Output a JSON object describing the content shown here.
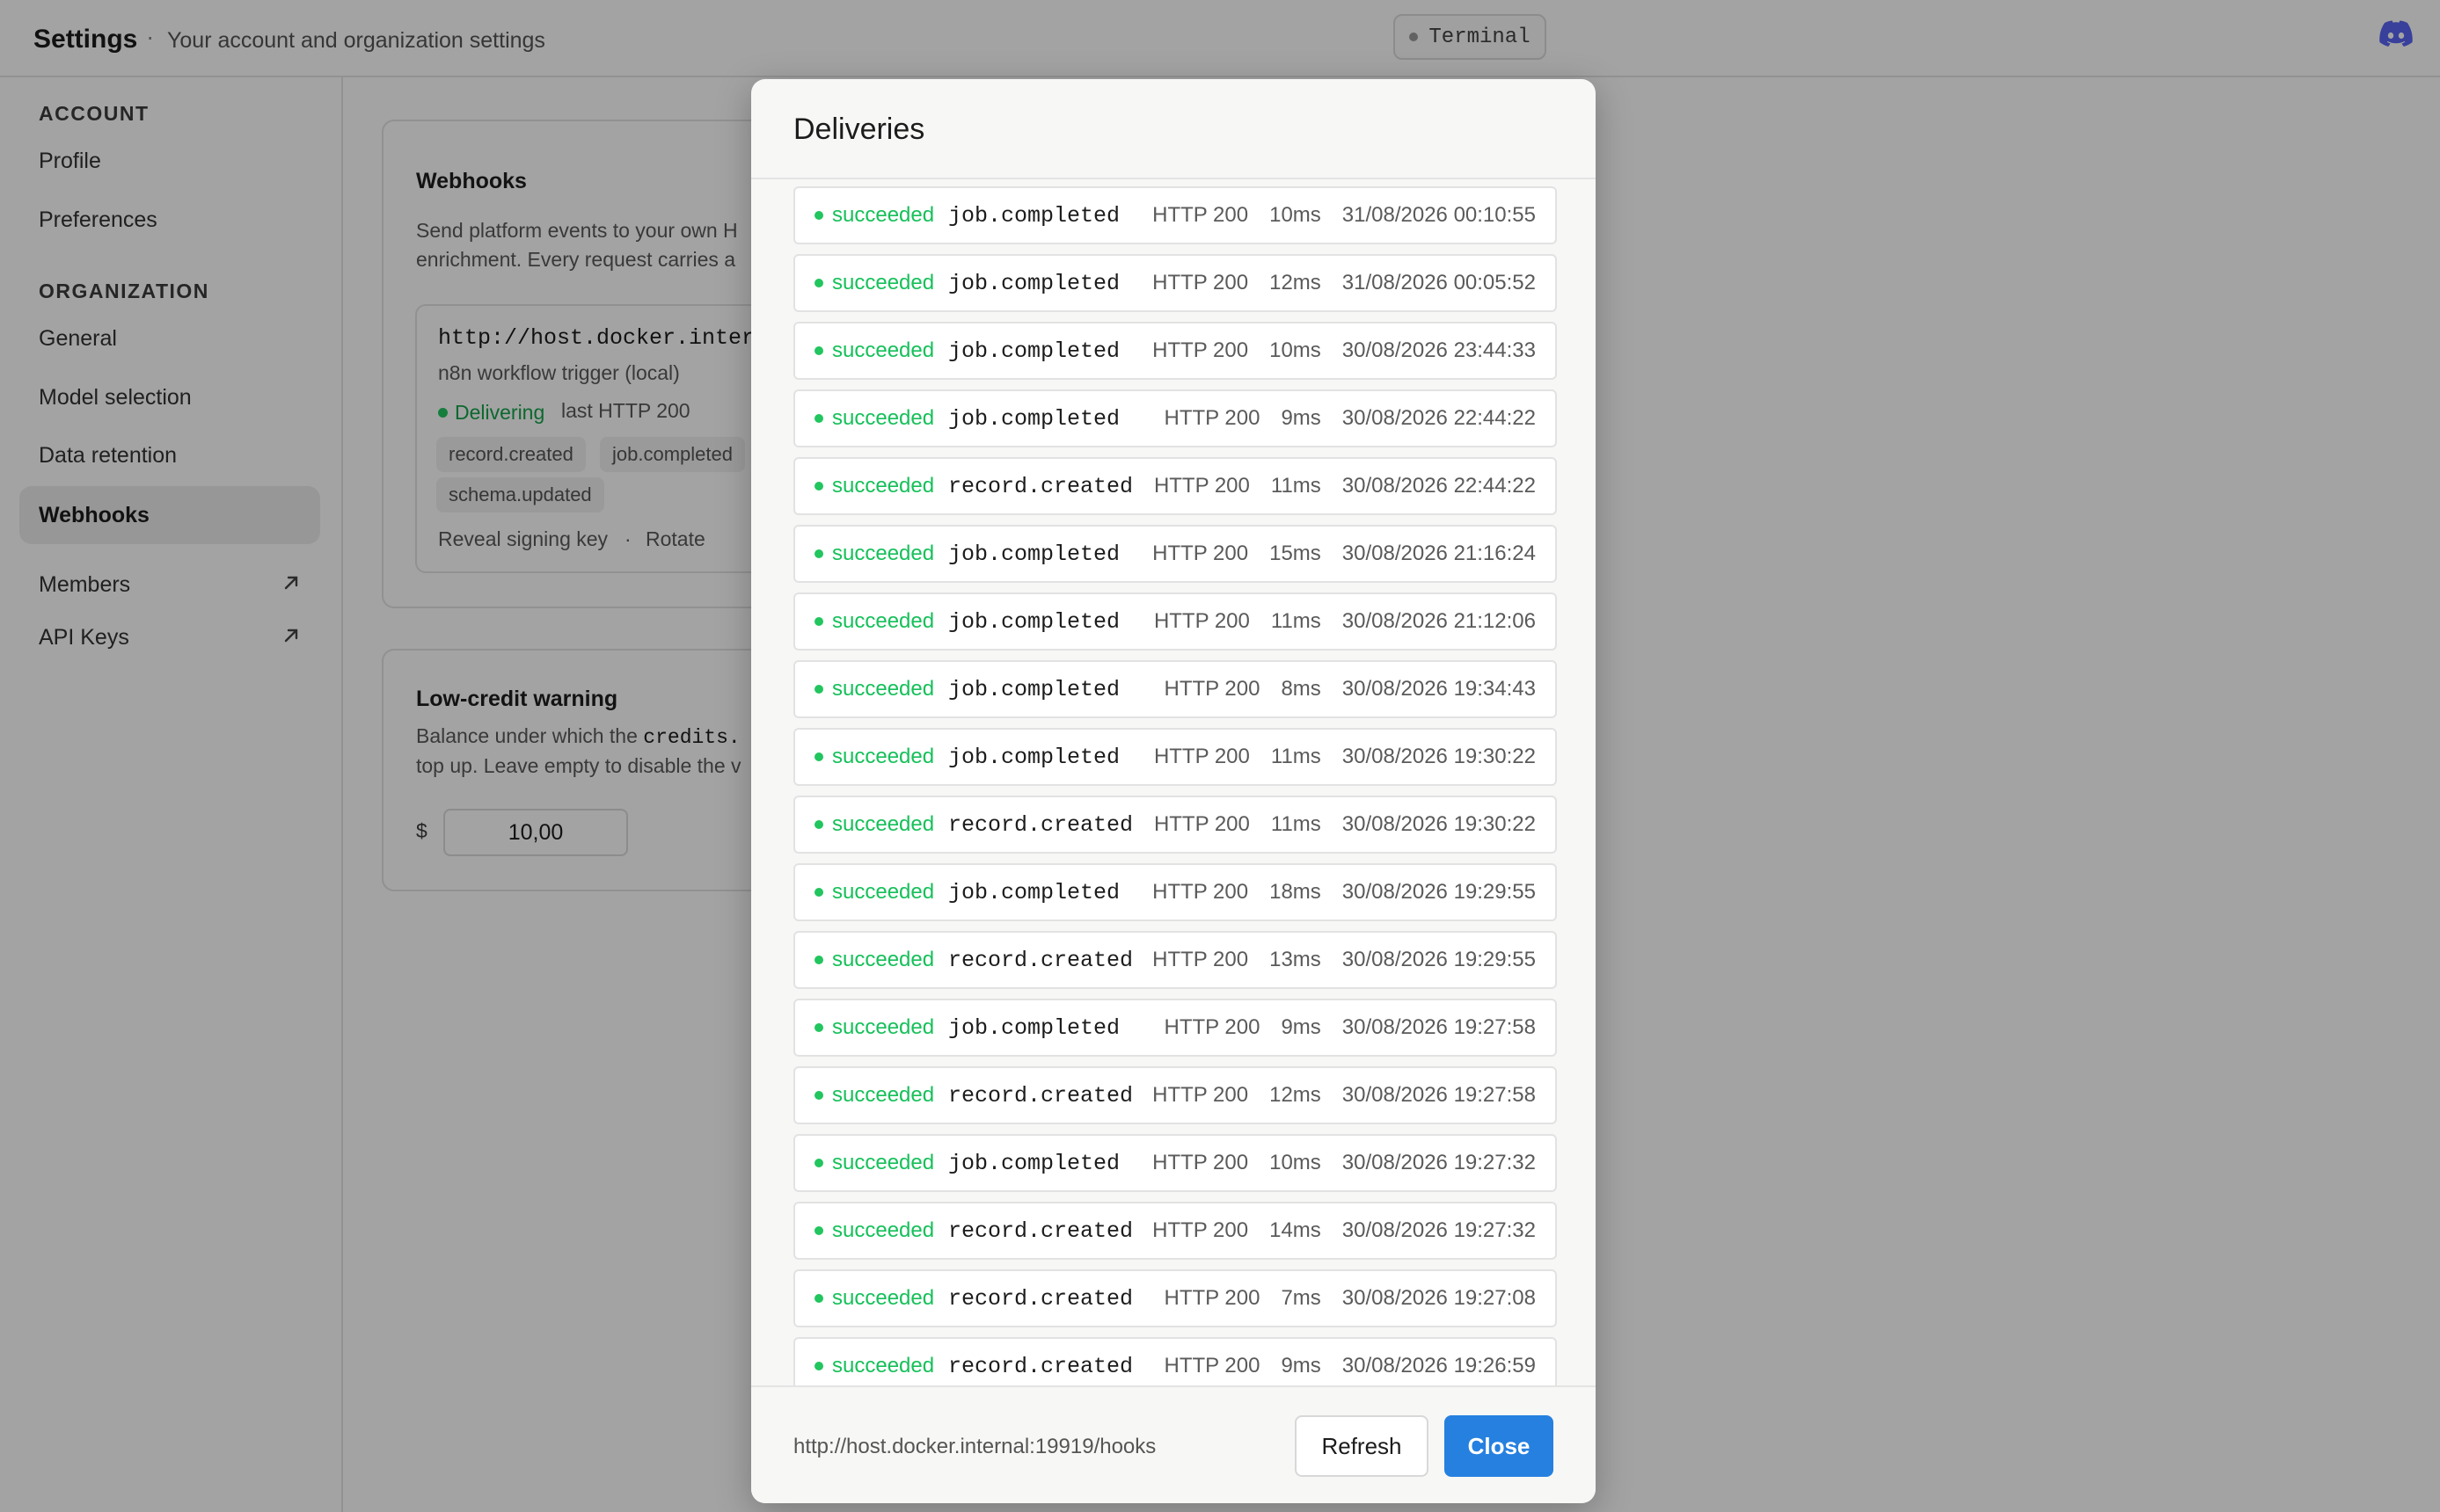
{
  "header": {
    "title": "Settings",
    "separator": "·",
    "subtitle": "Your account and organization settings",
    "terminal_label": "Terminal"
  },
  "sidebar": {
    "account_label": "ACCOUNT",
    "organization_label": "ORGANIZATION",
    "items": [
      {
        "label": "Profile"
      },
      {
        "label": "Preferences"
      },
      {
        "label": "General"
      },
      {
        "label": "Model selection"
      },
      {
        "label": "Data retention"
      },
      {
        "label": "Webhooks",
        "active": true
      },
      {
        "label": "Members",
        "external": true
      },
      {
        "label": "API Keys",
        "external": true
      }
    ]
  },
  "webhooks_card": {
    "title": "Webhooks",
    "desc_line1": "Send platform events to your own H",
    "desc_line2": "enrichment. Every request carries a",
    "endpoint": {
      "url": "http://host.docker.intern",
      "name": "n8n workflow trigger (local)",
      "status": "Delivering",
      "last": "last HTTP 200",
      "tags": [
        "record.created",
        "job.completed",
        "schema.updated"
      ],
      "reveal": "Reveal signing key",
      "sep": "·",
      "rotate": "Rotate"
    }
  },
  "credit_card": {
    "title": "Low-credit warning",
    "desc_line1_prefix": "Balance under which the ",
    "desc_line1_code": "credits.",
    "desc_line2": "top up. Leave empty to disable the v",
    "currency": "$",
    "amount": "10,00"
  },
  "modal": {
    "title": "Deliveries",
    "deliveries": [
      {
        "status": "succeeded",
        "event": "job.completed",
        "http": "HTTP 200",
        "duration": "10ms",
        "time": "31/08/2026 00:10:55"
      },
      {
        "status": "succeeded",
        "event": "job.completed",
        "http": "HTTP 200",
        "duration": "12ms",
        "time": "31/08/2026 00:05:52"
      },
      {
        "status": "succeeded",
        "event": "job.completed",
        "http": "HTTP 200",
        "duration": "10ms",
        "time": "30/08/2026 23:44:33"
      },
      {
        "status": "succeeded",
        "event": "job.completed",
        "http": "HTTP 200",
        "duration": "9ms",
        "time": "30/08/2026 22:44:22"
      },
      {
        "status": "succeeded",
        "event": "record.created",
        "http": "HTTP 200",
        "duration": "11ms",
        "time": "30/08/2026 22:44:22"
      },
      {
        "status": "succeeded",
        "event": "job.completed",
        "http": "HTTP 200",
        "duration": "15ms",
        "time": "30/08/2026 21:16:24"
      },
      {
        "status": "succeeded",
        "event": "job.completed",
        "http": "HTTP 200",
        "duration": "11ms",
        "time": "30/08/2026 21:12:06"
      },
      {
        "status": "succeeded",
        "event": "job.completed",
        "http": "HTTP 200",
        "duration": "8ms",
        "time": "30/08/2026 19:34:43"
      },
      {
        "status": "succeeded",
        "event": "job.completed",
        "http": "HTTP 200",
        "duration": "11ms",
        "time": "30/08/2026 19:30:22"
      },
      {
        "status": "succeeded",
        "event": "record.created",
        "http": "HTTP 200",
        "duration": "11ms",
        "time": "30/08/2026 19:30:22"
      },
      {
        "status": "succeeded",
        "event": "job.completed",
        "http": "HTTP 200",
        "duration": "18ms",
        "time": "30/08/2026 19:29:55"
      },
      {
        "status": "succeeded",
        "event": "record.created",
        "http": "HTTP 200",
        "duration": "13ms",
        "time": "30/08/2026 19:29:55"
      },
      {
        "status": "succeeded",
        "event": "job.completed",
        "http": "HTTP 200",
        "duration": "9ms",
        "time": "30/08/2026 19:27:58"
      },
      {
        "status": "succeeded",
        "event": "record.created",
        "http": "HTTP 200",
        "duration": "12ms",
        "time": "30/08/2026 19:27:58"
      },
      {
        "status": "succeeded",
        "event": "job.completed",
        "http": "HTTP 200",
        "duration": "10ms",
        "time": "30/08/2026 19:27:32"
      },
      {
        "status": "succeeded",
        "event": "record.created",
        "http": "HTTP 200",
        "duration": "14ms",
        "time": "30/08/2026 19:27:32"
      },
      {
        "status": "succeeded",
        "event": "record.created",
        "http": "HTTP 200",
        "duration": "7ms",
        "time": "30/08/2026 19:27:08"
      },
      {
        "status": "succeeded",
        "event": "record.created",
        "http": "HTTP 200",
        "duration": "9ms",
        "time": "30/08/2026 19:26:59"
      }
    ],
    "footer_url": "http://host.docker.internal:19919/hooks",
    "refresh_label": "Refresh",
    "close_label": "Close"
  }
}
